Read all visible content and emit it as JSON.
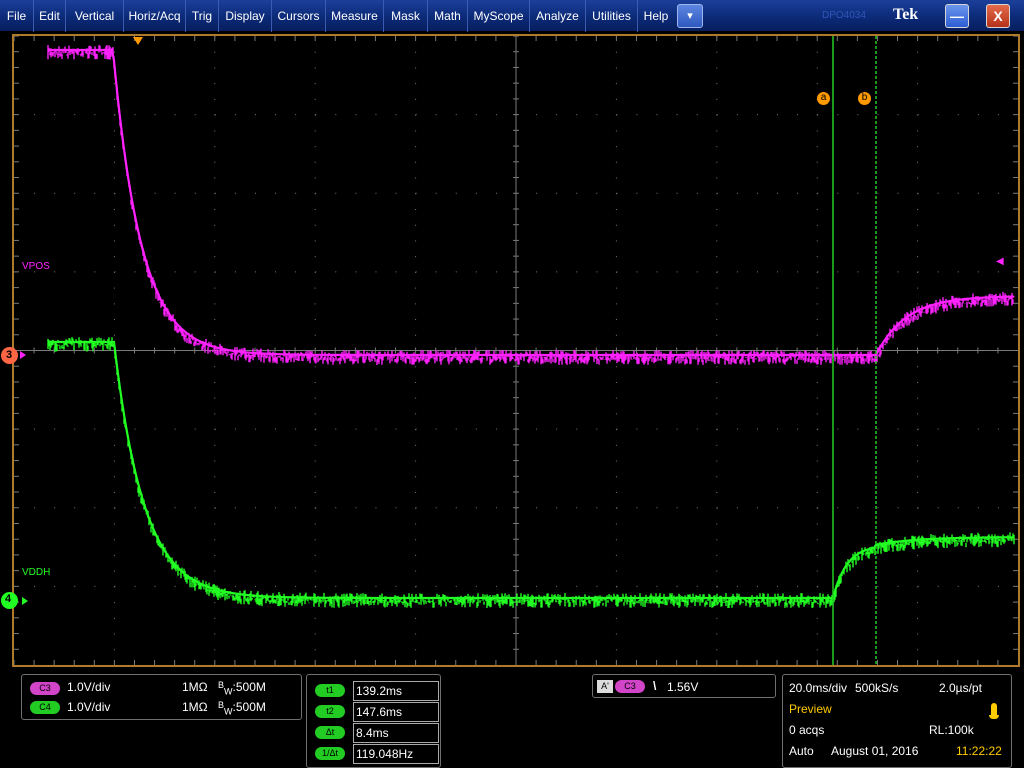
{
  "menu": {
    "items": [
      "File",
      "Edit",
      "Vertical",
      "Horiz/Acq",
      "Trig",
      "Display",
      "Cursors",
      "Measure",
      "Mask",
      "Math",
      "MyScope",
      "Analyze",
      "Utilities",
      "Help"
    ],
    "dropdown_icon": "▾",
    "model": "DPO4034",
    "logo": "Tek",
    "minimize_icon": "—",
    "close_icon": "X"
  },
  "colors": {
    "ch3": "#ff22ff",
    "ch4": "#22ff22",
    "cursor": "#22cc22",
    "marker": "#ff9900",
    "frame": "#b07a2c",
    "grid": "#7a7a7a"
  },
  "display": {
    "ch3_label": "VPOS",
    "ch4_label": "VDDH",
    "ch3_marker": "3",
    "ch4_marker": "4",
    "cursor_a_label": "a",
    "cursor_b_label": "b",
    "trigger_arrow": "◀",
    "trigger_pos_arrow": "▼"
  },
  "channels": [
    {
      "badge": "C3",
      "scale": "1.0V/div",
      "impedance": "1MΩ",
      "bw_prefix": "B",
      "bw_sub": "W",
      "bw": ":500M"
    },
    {
      "badge": "C4",
      "scale": "1.0V/div",
      "impedance": "1MΩ",
      "bw_prefix": "B",
      "bw_sub": "W",
      "bw": ":500M"
    }
  ],
  "cursors": [
    {
      "label": "t1",
      "value": "139.2ms"
    },
    {
      "label": "t2",
      "value": "147.6ms"
    },
    {
      "label": "Δt",
      "value": "8.4ms"
    },
    {
      "label": "1/Δt",
      "value": "119.048Hz"
    }
  ],
  "trigger": {
    "mode_badge": "A'",
    "source_badge": "C3",
    "slope_icon": "\\",
    "level": "1.56V"
  },
  "acquisition": {
    "timebase": "20.0ms/div",
    "sample_rate": "500kS/s",
    "resolution": "2.0µs/pt",
    "mode": "Preview",
    "acqs": "0 acqs",
    "record_length": "RL:100k",
    "trigger_mode": "Auto",
    "date": "August 01, 2016",
    "time": "11:22:22"
  }
}
